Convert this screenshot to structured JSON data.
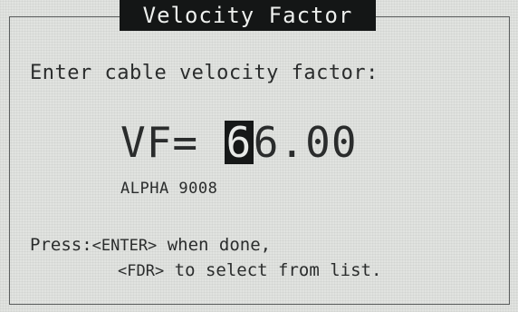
{
  "title": "Velocity Factor",
  "prompt": "Enter cable velocity factor:",
  "vf": {
    "label": "VF=",
    "cursor_digit": "6",
    "rest": "6.00"
  },
  "cable_name": "ALPHA 9008",
  "help": {
    "press_label": "Press:",
    "enter_key": "<ENTER>",
    "enter_text": " when done,",
    "fdr_key": "<FDR>",
    "fdr_text": " to select from list."
  }
}
